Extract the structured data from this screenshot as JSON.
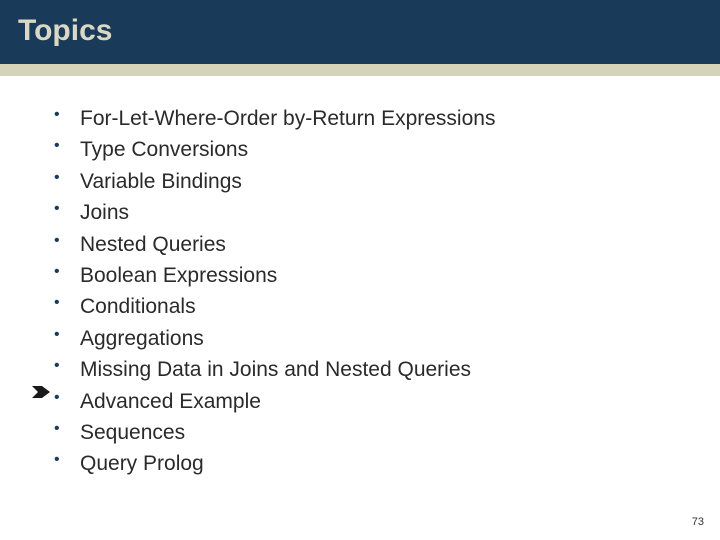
{
  "header": {
    "title": "Topics"
  },
  "colors": {
    "headerBg": "#1a3a5a",
    "headerText": "#d8d8c4",
    "stripe": "#d5d4b8",
    "bulletDot": "#1a3a5a",
    "bodyText": "#2a2a2a"
  },
  "bullets": [
    {
      "text": "For-Let-Where-Order by-Return Expressions"
    },
    {
      "text": "Type Conversions"
    },
    {
      "text": "Variable Bindings"
    },
    {
      "text": "Joins"
    },
    {
      "text": "Nested Queries"
    },
    {
      "text": "Boolean Expressions"
    },
    {
      "text": "Conditionals"
    },
    {
      "text": "Aggregations"
    },
    {
      "text": "Missing Data in Joins and Nested Queries"
    },
    {
      "text": "Advanced Example"
    },
    {
      "text": "Sequences"
    },
    {
      "text": "Query Prolog"
    }
  ],
  "markerIndex": 9,
  "pageNumber": "73"
}
